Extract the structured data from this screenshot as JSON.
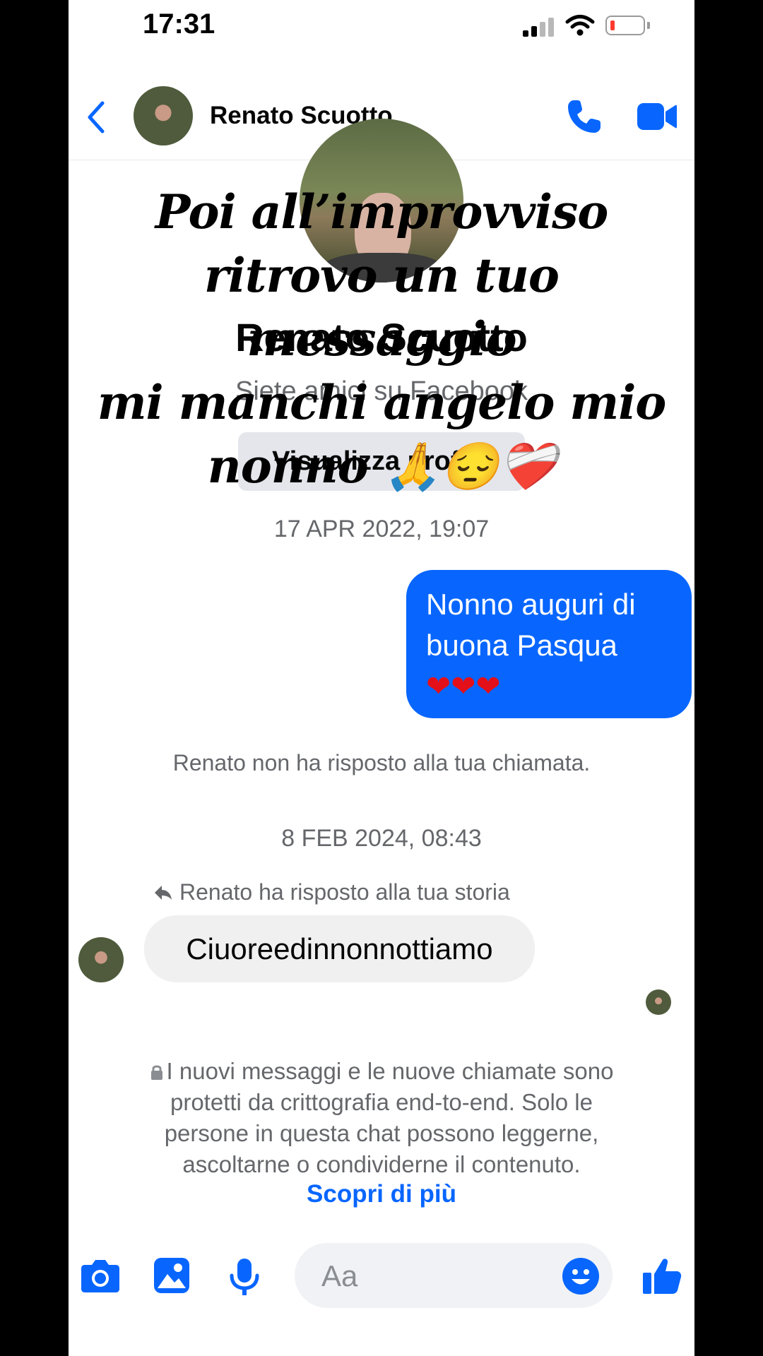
{
  "status_bar": {
    "time": "17:31"
  },
  "header": {
    "contact_name": "Renato Scuotto"
  },
  "profile": {
    "name": "Renato Scuotto",
    "friends_text": "Siete amici su Facebook",
    "view_profile_label": "Visualizza profilo"
  },
  "overlay_caption": {
    "line1": "Poi all’improvviso",
    "line2": "ritrovo un tuo messaggio",
    "line3": "mi manchi angelo mio",
    "line4": "nonno 🙏😔❤️‍🩹"
  },
  "messages": {
    "timestamp1": "17 APR 2022, 19:07",
    "outgoing_line1": "Nonno auguri di",
    "outgoing_line2": "buona Pasqua",
    "outgoing_hearts": "❤❤❤",
    "missed_call": "Renato non ha risposto alla tua chiamata.",
    "timestamp2": "8 FEB 2024, 08:43",
    "story_reply_note": "Renato ha risposto alla tua storia",
    "incoming_text": "Ciuoreedinnonnottiamo"
  },
  "encryption_notice": {
    "line1": "I nuovi messaggi e le nuove chiamate sono",
    "line2": "protetti da crittografia end-to-end. Solo le",
    "line3": "persone in questa chat possono leggerne,",
    "line4": "ascoltarne o condividerne il contenuto.",
    "learn_more": "Scopri di più"
  },
  "composer": {
    "placeholder": "Aa"
  },
  "colors": {
    "accent": "#0866ff",
    "outgoing_bubble": "#0866ff",
    "incoming_bubble": "#f0f0f0",
    "secondary_text": "#65676b"
  },
  "icons": [
    "signal-icon",
    "wifi-icon",
    "battery-icon",
    "back-chevron-icon",
    "phone-icon",
    "video-call-icon",
    "reply-arrow-icon",
    "lock-icon",
    "camera-icon",
    "gallery-icon",
    "microphone-icon",
    "emoji-icon",
    "like-icon"
  ]
}
